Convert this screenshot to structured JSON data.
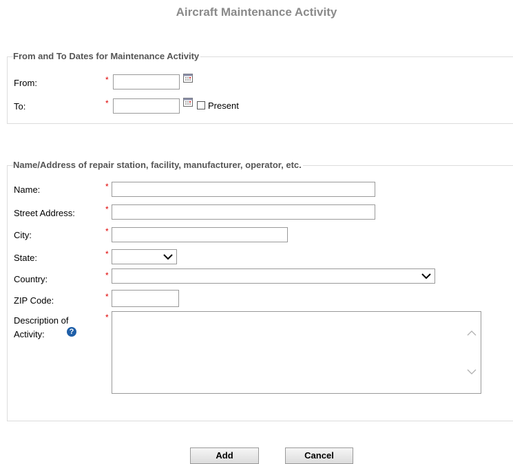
{
  "page": {
    "title": "Aircraft Maintenance Activity"
  },
  "dates_section": {
    "legend": "From and To Dates for Maintenance Activity",
    "from_label": "From:",
    "to_label": "To:",
    "from_value": "",
    "to_value": "",
    "present_label": "Present",
    "present_checked": false
  },
  "address_section": {
    "legend": "Name/Address of repair station, facility, manufacturer, operator, etc.",
    "name_label": "Name:",
    "street_label": "Street Address:",
    "city_label": "City:",
    "state_label": "State:",
    "country_label": "Country:",
    "zip_label": "ZIP Code:",
    "desc_label_line1": "Description of",
    "desc_label_line2": "Activity:",
    "name_value": "",
    "street_value": "",
    "city_value": "",
    "state_value": "",
    "country_value": "",
    "zip_value": "",
    "desc_value": ""
  },
  "required_marker": "*",
  "help_glyph": "?",
  "buttons": {
    "add": "Add",
    "cancel": "Cancel"
  },
  "colors": {
    "required": "#e00000",
    "help_icon": "#1f5fa8",
    "title": "#8a8a8a"
  }
}
